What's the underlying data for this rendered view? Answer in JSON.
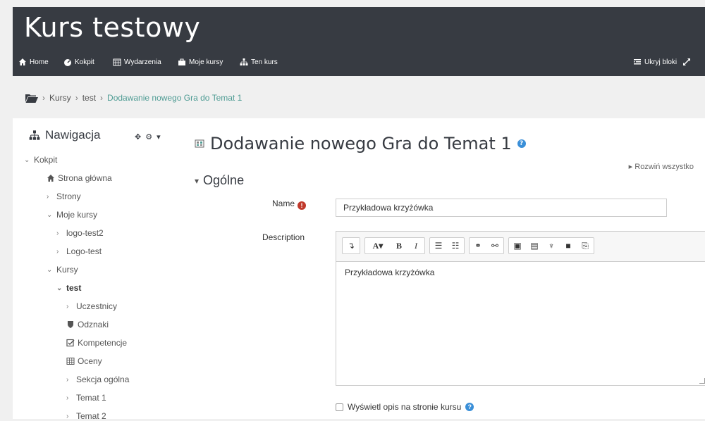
{
  "site": {
    "title": "Kurs testowy"
  },
  "nav": {
    "home": "Home",
    "kokpit": "Kokpit",
    "wydarzenia": "Wydarzenia",
    "moje_kursy": "Moje kursy",
    "ten_kurs": "Ten kurs",
    "ukryj_bloki": "Ukryj bloki"
  },
  "breadcrumb": {
    "items": [
      "Kursy",
      "test",
      "Dodawanie nowego Gra do Temat 1"
    ],
    "separator": "›"
  },
  "navblock": {
    "title": "Nawigacja",
    "items": [
      {
        "label": "Kokpit",
        "chev": "⌄"
      },
      {
        "label": "Strona główna",
        "icon": "home-icon"
      },
      {
        "label": "Strony",
        "chev": "›"
      },
      {
        "label": "Moje kursy",
        "chev": "⌄"
      },
      {
        "label": "logo-test2",
        "chev": "›"
      },
      {
        "label": "Logo-test",
        "chev": "›"
      },
      {
        "label": "Kursy",
        "chev": "⌄"
      },
      {
        "label": "test",
        "chev": "⌄"
      },
      {
        "label": "Uczestnicy",
        "chev": "›"
      },
      {
        "label": "Odznaki",
        "icon": "shield-icon"
      },
      {
        "label": "Kompetencje",
        "icon": "check-square-icon"
      },
      {
        "label": "Oceny",
        "icon": "table-icon"
      },
      {
        "label": "Sekcja ogólna",
        "chev": "›"
      },
      {
        "label": "Temat 1",
        "chev": "›"
      },
      {
        "label": "Temat 2",
        "chev": "›"
      }
    ]
  },
  "main": {
    "heading": "Dodawanie nowego Gra do Temat 1",
    "expand_all": "Rozwiń wszystko",
    "section": "Ogólne",
    "name_label": "Name",
    "name_value": "Przykładowa krzyżówka",
    "description_label": "Description",
    "description_value": "Przykładowa krzyżówka",
    "show_desc_label": "Wyświetl opis na stronie kursu"
  },
  "colors": {
    "header_bg": "#373b42",
    "accent": "#4f9c94",
    "help": "#3a8fd8",
    "required": "#c0392b"
  }
}
